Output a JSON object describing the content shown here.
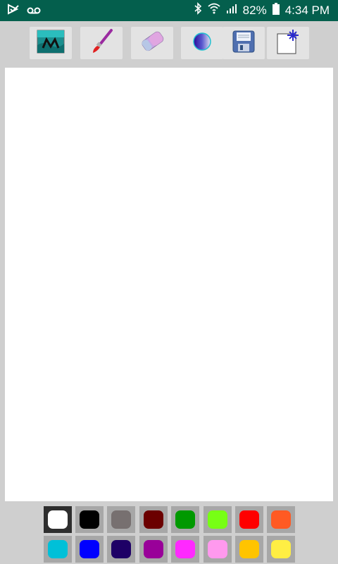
{
  "status_bar": {
    "battery": "82%",
    "time": "4:34 PM",
    "icons": [
      "notification-check-icon",
      "voicemail-icon",
      "bluetooth-icon",
      "wifi-icon",
      "signal-icon",
      "battery-icon"
    ]
  },
  "toolbar": {
    "tools": [
      {
        "name": "background-image-tool",
        "icon": "landscape-thumbnail-icon"
      },
      {
        "name": "brush-tool",
        "icon": "paintbrush-icon"
      },
      {
        "name": "eraser-tool",
        "icon": "eraser-icon"
      },
      {
        "name": "brush-size-tool",
        "icon": "gradient-circle-icon"
      },
      {
        "name": "save-tool",
        "icon": "floppy-disk-icon"
      },
      {
        "name": "new-canvas-tool",
        "icon": "new-page-icon"
      }
    ]
  },
  "palette": {
    "selected_index": 0,
    "colors": [
      "#ffffff",
      "#000000",
      "#777070",
      "#6b0000",
      "#009900",
      "#77ff14",
      "#ff0000",
      "#ff5a23",
      "#00c0d8",
      "#0000ff",
      "#1e0066",
      "#990099",
      "#ff29ff",
      "#ff99ee",
      "#ffc400",
      "#ffee44"
    ]
  }
}
